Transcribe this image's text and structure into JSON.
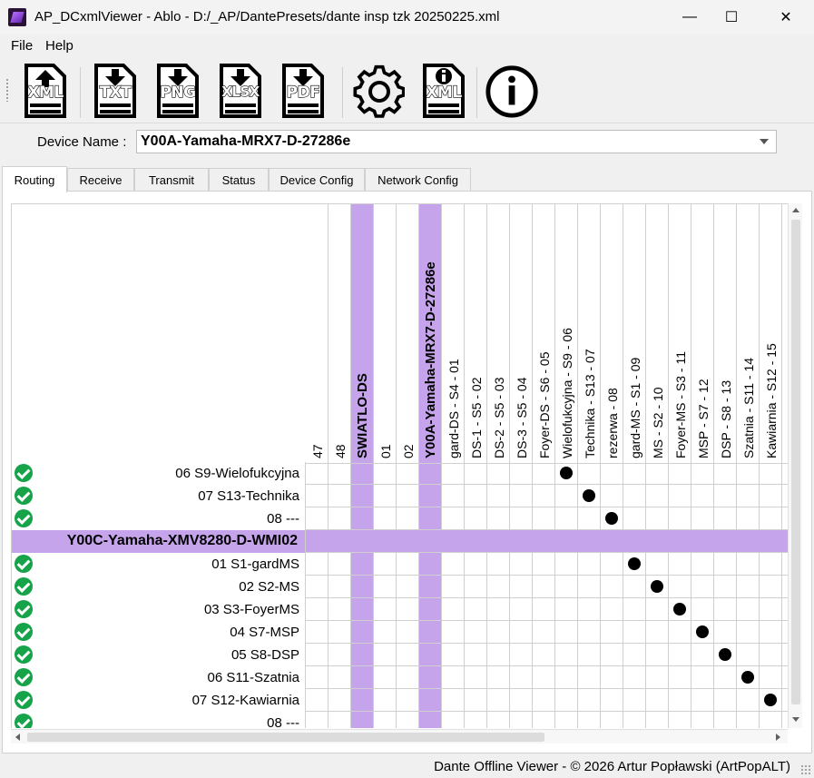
{
  "window": {
    "title": "AP_DCxmlViewer - Ablo - D:/_AP/DantePresets/dante insp tzk 20250225.xml",
    "minimize_glyph": "—",
    "maximize_glyph": "☐",
    "close_glyph": "✕"
  },
  "menu": {
    "items": [
      "File",
      "Help"
    ]
  },
  "toolbar": {
    "buttons": [
      {
        "name": "open-xml",
        "label": "XML",
        "icon": "upload-document-icon"
      },
      {
        "name": "export-txt",
        "label": "TXT",
        "icon": "download-document-icon"
      },
      {
        "name": "export-png",
        "label": "PNG",
        "icon": "download-document-icon"
      },
      {
        "name": "export-xlsx",
        "label": "XLSX",
        "icon": "download-document-icon"
      },
      {
        "name": "export-pdf",
        "label": "PDF",
        "icon": "download-document-icon"
      },
      {
        "name": "settings",
        "label": "",
        "icon": "gear-icon"
      },
      {
        "name": "xml-info",
        "label": "XML",
        "icon": "info-document-icon"
      },
      {
        "name": "about",
        "label": "",
        "icon": "info-icon"
      }
    ]
  },
  "device": {
    "label": "Device Name :",
    "selected": "Y00A-Yamaha-MRX7-D-27286e"
  },
  "tabs": [
    "Routing",
    "Receive",
    "Transmit",
    "Status",
    "Device Config",
    "Network Config"
  ],
  "active_tab": "Routing",
  "colors": {
    "highlight": "#c6a4ec",
    "check": "#16a34a"
  },
  "grid": {
    "columns": [
      {
        "label": "47",
        "highlight": false,
        "bold": false
      },
      {
        "label": "48",
        "highlight": false,
        "bold": false
      },
      {
        "label": "SWIATLO-DS",
        "highlight": true,
        "bold": true
      },
      {
        "label": "01",
        "highlight": false,
        "bold": false
      },
      {
        "label": "02",
        "highlight": false,
        "bold": false
      },
      {
        "label": "Y00A-Yamaha-MRX7-D-27286e",
        "highlight": true,
        "bold": true
      },
      {
        "label": "gard-DS - S4 - 01",
        "highlight": false,
        "bold": false
      },
      {
        "label": "DS-1 - S5 - 02",
        "highlight": false,
        "bold": false
      },
      {
        "label": "DS-2 - S5 - 03",
        "highlight": false,
        "bold": false
      },
      {
        "label": "DS-3 - S5 - 04",
        "highlight": false,
        "bold": false
      },
      {
        "label": "Foyer-DS - S6 - 05",
        "highlight": false,
        "bold": false
      },
      {
        "label": "Wielofukcyjna - S9 - 06",
        "highlight": false,
        "bold": false
      },
      {
        "label": "Technika - S13 - 07",
        "highlight": false,
        "bold": false
      },
      {
        "label": "rezerwa - 08",
        "highlight": false,
        "bold": false
      },
      {
        "label": "gard-MS - S1 - 09",
        "highlight": false,
        "bold": false
      },
      {
        "label": "MS - S2 - 10",
        "highlight": false,
        "bold": false
      },
      {
        "label": "Foyer-MS - S3 - 11",
        "highlight": false,
        "bold": false
      },
      {
        "label": "MSP - S7 - 12",
        "highlight": false,
        "bold": false
      },
      {
        "label": "DSP - S8 - 13",
        "highlight": false,
        "bold": false
      },
      {
        "label": "Szatnia - S11 - 14",
        "highlight": false,
        "bold": false
      },
      {
        "label": "Kawiarnia - S12 - 15",
        "highlight": false,
        "bold": false
      }
    ],
    "rows": [
      {
        "label": "06 S9-Wielofukcyjna",
        "group": false,
        "ok": true,
        "dot_col": 11
      },
      {
        "label": "07 S13-Technika",
        "group": false,
        "ok": true,
        "dot_col": 12
      },
      {
        "label": "08 ---",
        "group": false,
        "ok": true,
        "dot_col": 13
      },
      {
        "label": "Y00C-Yamaha-XMV8280-D-WMI02",
        "group": true,
        "ok": false,
        "dot_col": null
      },
      {
        "label": "01 S1-gardMS",
        "group": false,
        "ok": true,
        "dot_col": 14
      },
      {
        "label": "02 S2-MS",
        "group": false,
        "ok": true,
        "dot_col": 15
      },
      {
        "label": "03 S3-FoyerMS",
        "group": false,
        "ok": true,
        "dot_col": 16
      },
      {
        "label": "04 S7-MSP",
        "group": false,
        "ok": true,
        "dot_col": 17
      },
      {
        "label": "05 S8-DSP",
        "group": false,
        "ok": true,
        "dot_col": 18
      },
      {
        "label": "06 S11-Szatnia",
        "group": false,
        "ok": true,
        "dot_col": 19
      },
      {
        "label": "07 S12-Kawiarnia",
        "group": false,
        "ok": true,
        "dot_col": 20
      },
      {
        "label": "08 ---",
        "group": false,
        "ok": true,
        "dot_col": null
      }
    ]
  },
  "status": "Dante Offline Viewer - © 2026 Artur Popławski (ArtPopALT)"
}
